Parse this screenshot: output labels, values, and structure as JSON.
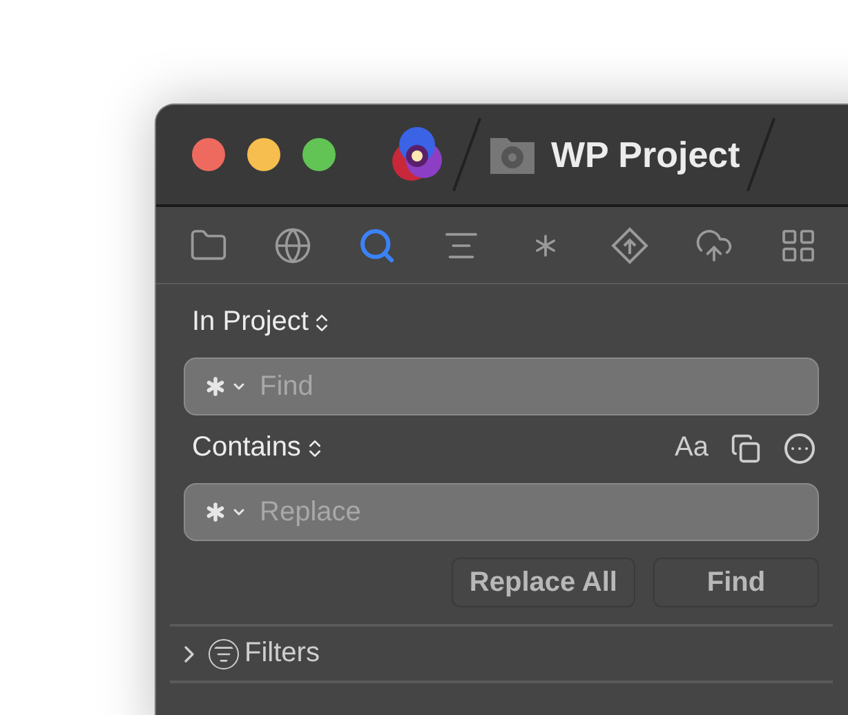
{
  "window": {
    "title": "WP Project"
  },
  "toolbar": [
    {
      "kind": "folder",
      "selected": false
    },
    {
      "kind": "globe",
      "selected": false
    },
    {
      "kind": "search",
      "selected": true
    },
    {
      "kind": "lines",
      "selected": false
    },
    {
      "kind": "asterisk",
      "selected": false
    },
    {
      "kind": "diamond",
      "selected": false
    },
    {
      "kind": "cloud",
      "selected": false
    },
    {
      "kind": "grid",
      "selected": false
    }
  ],
  "scope": {
    "label": "In Project"
  },
  "find_field": {
    "placeholder": "Find"
  },
  "match": {
    "label": "Contains"
  },
  "options": [
    {
      "kind": "text",
      "label": "Aa"
    },
    {
      "kind": "copy"
    },
    {
      "kind": "more"
    }
  ],
  "replace_field": {
    "placeholder": "Replace"
  },
  "buttons": [
    "Replace All",
    "Find"
  ],
  "filters": {
    "label": "Filters",
    "expanded": false
  }
}
